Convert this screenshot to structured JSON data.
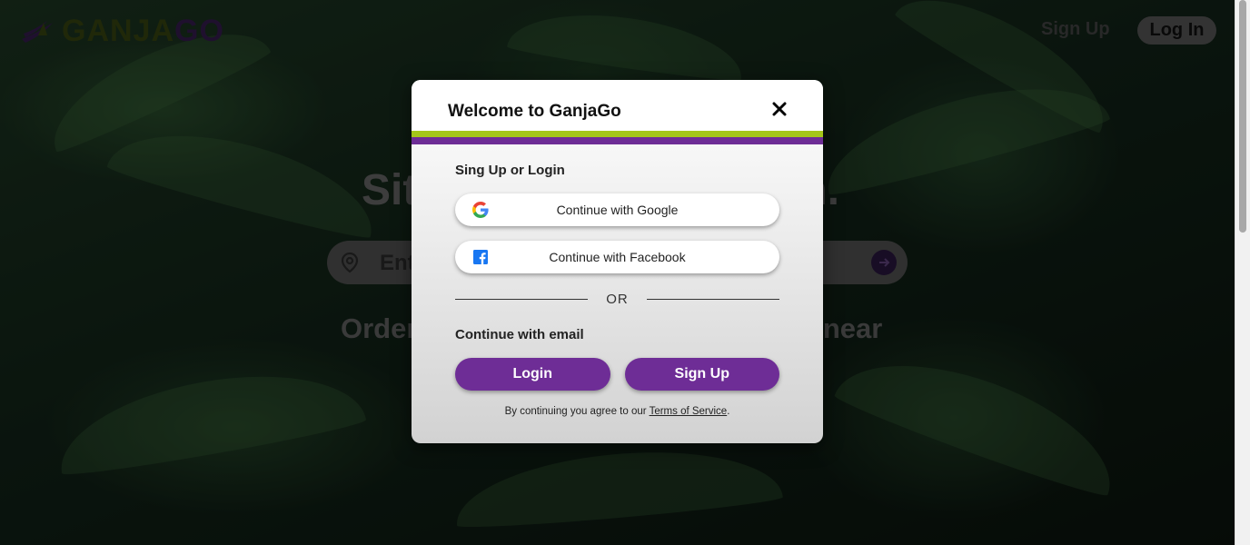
{
  "header": {
    "logo_part1": "GANJA",
    "logo_part2": "GO",
    "signup_label": "Sign Up",
    "login_label": "Log In"
  },
  "hero": {
    "title_left": "Sit",
    "title_right": "gh.",
    "search_placeholder": "Ente",
    "subtitle_left": "Order",
    "subtitle_right": "s near"
  },
  "modal": {
    "title": "Welcome to GanjaGo",
    "section_label": "Sing Up or Login",
    "google_label": "Continue with Google",
    "facebook_label": "Continue with Facebook",
    "or_label": "OR",
    "email_label": "Continue with email",
    "login_label": "Login",
    "signup_label": "Sign Up",
    "tos_prefix": "By continuing you agree to our ",
    "tos_link": "Terms of Service",
    "tos_suffix": "."
  },
  "colors": {
    "brand_purple": "#6e2d96",
    "brand_green": "#a4c61a",
    "google_icon": "google-icon",
    "facebook_icon": "facebook-icon",
    "close_icon": "close-icon"
  }
}
